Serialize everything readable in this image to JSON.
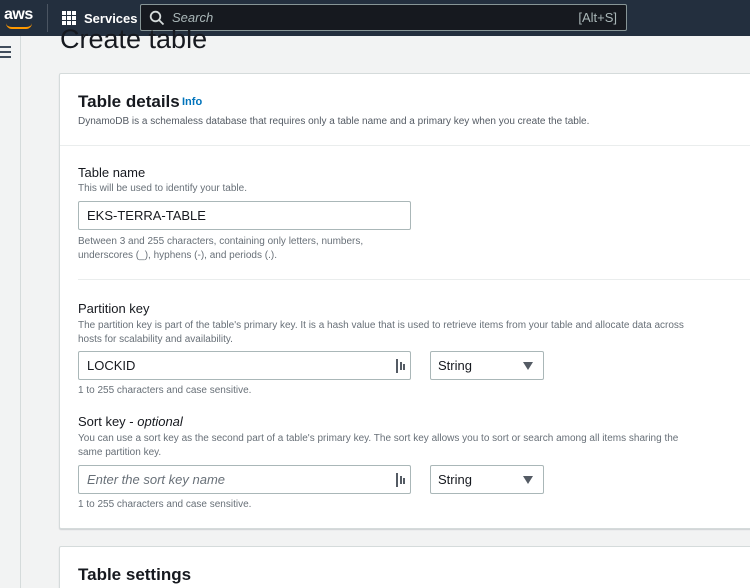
{
  "topnav": {
    "logo": "aws",
    "services_label": "Services",
    "search_placeholder": "Search",
    "search_shortcut": "[Alt+S]"
  },
  "page": {
    "title": "Create table"
  },
  "table_details": {
    "title": "Table details",
    "info": "Info",
    "description": "DynamoDB is a schemaless database that requires only a table name and a primary key when you create the table.",
    "table_name": {
      "label": "Table name",
      "description": "This will be used to identify your table.",
      "value": "EKS-TERRA-TABLE",
      "hint_line1": "Between 3 and 255 characters, containing only letters, numbers,",
      "hint_line2": "underscores (_), hyphens (-), and periods (.)."
    },
    "partition_key": {
      "label": "Partition key",
      "description_line1": "The partition key is part of the table's primary key. It is a hash value that is used to retrieve items from your table and allocate data across",
      "description_line2": "hosts for scalability and availability.",
      "value": "LOCKID",
      "type": "String",
      "hint": "1 to 255 characters and case sensitive."
    },
    "sort_key": {
      "label": "Sort key - ",
      "label_optional": "optional",
      "description_line1": "You can use a sort key as the second part of a table's primary key. The sort key allows you to sort or search among all items sharing the",
      "description_line2": "same partition key.",
      "placeholder": "Enter the sort key name",
      "type": "String",
      "hint": "1 to 255 characters and case sensitive."
    }
  },
  "table_settings": {
    "title": "Table settings"
  },
  "colors": {
    "nav_bg": "#232f3e",
    "brand_orange": "#ff9900",
    "link_blue": "#0073bb"
  },
  "icons": [
    "aws-logo",
    "services-grid-icon",
    "search-icon",
    "menu-icon",
    "password-manager-icon",
    "caret-down-icon"
  ]
}
